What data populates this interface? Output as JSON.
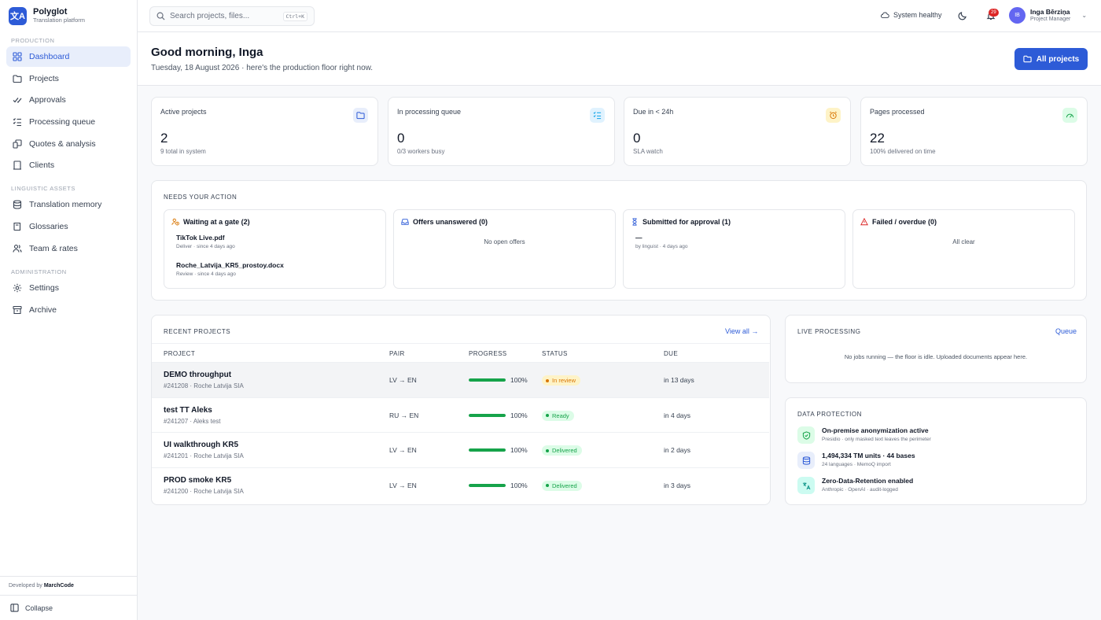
{
  "brand": {
    "name": "Polyglot",
    "subtitle": "Translation platform",
    "logo_glyph": "文A"
  },
  "sidebar": {
    "sections": [
      {
        "label": "PRODUCTION",
        "items": [
          {
            "label": "Dashboard",
            "icon": "dashboard-icon",
            "active": true
          },
          {
            "label": "Projects",
            "icon": "folder-icon"
          },
          {
            "label": "Approvals",
            "icon": "check-double-icon"
          },
          {
            "label": "Processing queue",
            "icon": "list-check-icon"
          },
          {
            "label": "Quotes & analysis",
            "icon": "quotes-icon"
          },
          {
            "label": "Clients",
            "icon": "building-icon"
          }
        ]
      },
      {
        "label": "LINGUISTIC ASSETS",
        "items": [
          {
            "label": "Translation memory",
            "icon": "database-icon"
          },
          {
            "label": "Glossaries",
            "icon": "book-icon"
          },
          {
            "label": "Team & rates",
            "icon": "users-icon"
          }
        ]
      },
      {
        "label": "ADMINISTRATION",
        "items": [
          {
            "label": "Settings",
            "icon": "gear-icon"
          },
          {
            "label": "Archive",
            "icon": "archive-icon"
          }
        ]
      }
    ],
    "developed_by_prefix": "Developed by",
    "developed_by_name": "MarchCode",
    "collapse_label": "Collapse"
  },
  "topbar": {
    "search_placeholder": "Search projects, files...",
    "search_shortcut": "Ctrl+K",
    "system_status": "System healthy",
    "notification_count": "29",
    "user_initials": "IB",
    "user_name": "Inga Bērziņa",
    "user_role": "Project Manager"
  },
  "header": {
    "greeting": "Good morning, Inga",
    "date_line": "Tuesday, 18 August 2026 · here's the production floor right now.",
    "all_projects_label": "All projects"
  },
  "stats": [
    {
      "label": "Active projects",
      "value": "2",
      "sub": "9 total in system",
      "icon": "folder-icon",
      "color": "#2d5bd7",
      "bg": "#e8eefb"
    },
    {
      "label": "In processing queue",
      "value": "0",
      "sub": "0/3 workers busy",
      "icon": "list-check-icon",
      "color": "#0ea5e9",
      "bg": "#e0f2fe"
    },
    {
      "label": "Due in < 24h",
      "value": "0",
      "sub": "SLA watch",
      "icon": "alarm-icon",
      "color": "#d97706",
      "bg": "#fef3c7"
    },
    {
      "label": "Pages processed",
      "value": "22",
      "sub": "100% delivered on time",
      "icon": "gauge-icon",
      "color": "#16a34a",
      "bg": "#dcfce7"
    }
  ],
  "needs_action": {
    "title": "NEEDS YOUR ACTION",
    "boxes": [
      {
        "title": "Waiting at a gate (2)",
        "icon": "user-clock-icon",
        "color": "#d97706",
        "items": [
          {
            "name": "TikTok Live.pdf",
            "meta": "Deliver · since 4 days ago"
          },
          {
            "name": "Roche_Latvija_KR5_prostoy.docx",
            "meta": "Review · since 4 days ago"
          }
        ]
      },
      {
        "title": "Offers unanswered (0)",
        "icon": "inbox-icon",
        "color": "#2d5bd7",
        "empty": "No open offers"
      },
      {
        "title": "Submitted for approval (1)",
        "icon": "hourglass-icon",
        "color": "#2d5bd7",
        "items": [
          {
            "name": "—",
            "meta": "by linguist · 4 days ago"
          }
        ]
      },
      {
        "title": "Failed / overdue (0)",
        "icon": "warning-icon",
        "color": "#dc2626",
        "empty": "All clear"
      }
    ]
  },
  "recent": {
    "title": "RECENT PROJECTS",
    "view_all": "View all →",
    "columns": [
      "PROJECT",
      "PAIR",
      "PROGRESS",
      "STATUS",
      "DUE"
    ],
    "rows": [
      {
        "name": "DEMO throughput",
        "sub": "#241208 · Roche Latvija SIA",
        "pair": "LV → EN",
        "progress": 100,
        "progress_label": "100%",
        "status": "In review",
        "status_color": "#d97706",
        "status_bg": "#fef3c7",
        "due": "in 13 days"
      },
      {
        "name": "test TT Aleks",
        "sub": "#241207 · Aleks test",
        "pair": "RU → EN",
        "progress": 100,
        "progress_label": "100%",
        "status": "Ready",
        "status_color": "#16a34a",
        "status_bg": "#dcfce7",
        "due": "in 4 days"
      },
      {
        "name": "UI walkthrough KR5",
        "sub": "#241201 · Roche Latvija SIA",
        "pair": "LV → EN",
        "progress": 100,
        "progress_label": "100%",
        "status": "Delivered",
        "status_color": "#16a34a",
        "status_bg": "#dcfce7",
        "due": "in 2 days"
      },
      {
        "name": "PROD smoke KR5",
        "sub": "#241200 · Roche Latvija SIA",
        "pair": "LV → EN",
        "progress": 100,
        "progress_label": "100%",
        "status": "Delivered",
        "status_color": "#16a34a",
        "status_bg": "#dcfce7",
        "due": "in 3 days"
      }
    ]
  },
  "live": {
    "title": "LIVE PROCESSING",
    "link": "Queue",
    "empty": "No jobs running — the floor is idle. Uploaded documents appear here."
  },
  "protection": {
    "title": "DATA PROTECTION",
    "items": [
      {
        "title": "On-premise anonymization active",
        "sub": "Presidio · only masked text leaves the perimeter",
        "icon": "shield-icon",
        "color": "#16a34a",
        "bg": "#dcfce7"
      },
      {
        "title": "1,494,334 TM units · 44 bases",
        "sub": "24 languages · MemoQ import",
        "icon": "database-icon",
        "color": "#2d5bd7",
        "bg": "#e8eefb"
      },
      {
        "title": "Zero-Data-Retention enabled",
        "sub": "Anthropic · OpenAI · audit-logged",
        "icon": "translate-icon",
        "color": "#0d9488",
        "bg": "#ccfbf1"
      }
    ]
  }
}
